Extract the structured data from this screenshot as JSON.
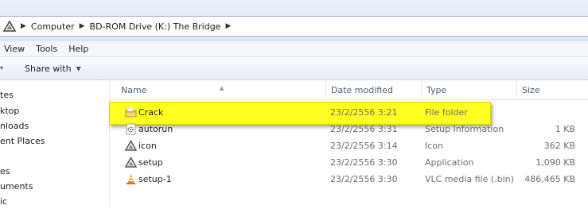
{
  "address": {
    "segments": [
      "Computer",
      "BD-ROM Drive (K:) The Bridge"
    ]
  },
  "menu": [
    "View",
    "Tools",
    "Help"
  ],
  "toolbar": {
    "share_with": "Share with"
  },
  "nav": [
    "tes",
    "ktop",
    "nloads",
    "ent Places",
    "es",
    "uments",
    "ic"
  ],
  "columns": {
    "name": "Name",
    "date": "Date modified",
    "type": "Type",
    "size": "Size"
  },
  "files": [
    {
      "name": "Crack",
      "date": "23/2/2556 3:21",
      "type": "File folder",
      "size": "",
      "icon": "folder-icon"
    },
    {
      "name": "autorun",
      "date": "23/2/2556 3:31",
      "type": "Setup Information",
      "size": "1 KB",
      "icon": "settings-file-icon"
    },
    {
      "name": "icon",
      "date": "23/2/2556 3:14",
      "type": "Icon",
      "size": "362 KB",
      "icon": "triangle-logo-icon"
    },
    {
      "name": "setup",
      "date": "23/2/2556 3:30",
      "type": "Application",
      "size": "1,090 KB",
      "icon": "triangle-logo-icon"
    },
    {
      "name": "setup-1",
      "date": "23/2/2556 3:30",
      "type": "VLC media file (.bin)",
      "size": "486,465 KB",
      "icon": "vlc-cone-icon"
    }
  ],
  "colors": {
    "highlight": "#ffff22",
    "header_text": "#4c607a"
  }
}
